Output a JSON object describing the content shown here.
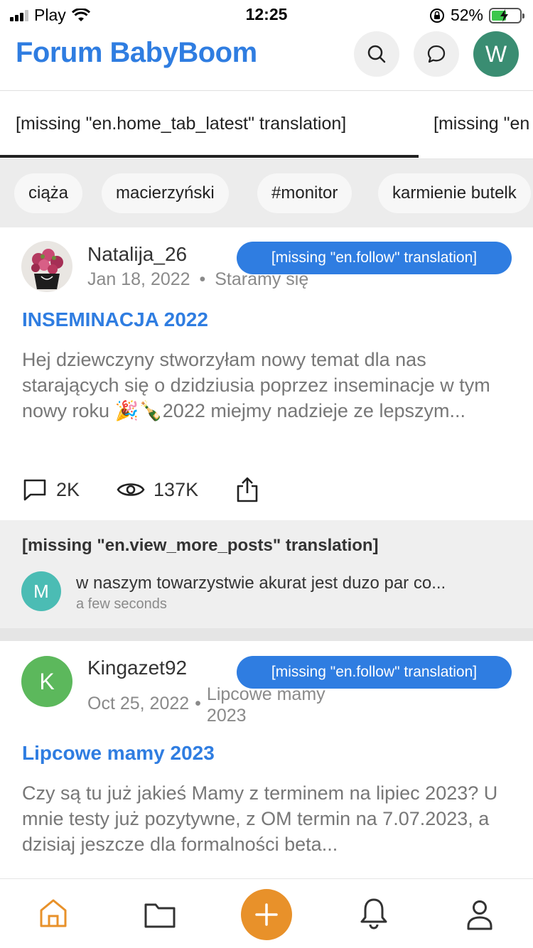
{
  "status_bar": {
    "carrier": "Play",
    "time": "12:25",
    "battery_percent": "52%",
    "battery_level": 0.52
  },
  "header": {
    "title": "Forum BabyBoom",
    "avatar_letter": "W",
    "icons": [
      "search-icon",
      "chat-bubble-icon"
    ]
  },
  "tabs": [
    {
      "label": "[missing \"en.home_tab_latest\" translation]",
      "active": true
    },
    {
      "label": "[missing \"en"
    }
  ],
  "tags": [
    "ciąża",
    "macierzyński",
    "#monitor",
    "karmienie butelk"
  ],
  "posts": [
    {
      "author": "Natalija_26",
      "date": "Jan 18, 2022",
      "group": "Staramy się",
      "follow_label": "[missing \"en.follow\" translation]",
      "title": "INSEMINACJA 2022",
      "excerpt": "Hej dziewczyny stworzyłam nowy temat dla nas starających się o dzidziusia poprzez inseminacje w tym nowy roku 🎉🍾2022 miejmy nadzieje ze lepszym...",
      "comments": "2K",
      "views": "137K",
      "more_posts_label": "[missing \"en.view_more_posts\" translation]",
      "reply": {
        "avatar_letter": "M",
        "text": "w naszym towarzystwie akurat jest duzo par co...",
        "time": "a few seconds"
      }
    },
    {
      "author": "Kingazet92",
      "avatar_letter": "K",
      "date": "Oct 25, 2022",
      "group": "Lipcowe mamy 2023",
      "follow_label": "[missing \"en.follow\" translation]",
      "title": "Lipcowe mamy 2023",
      "excerpt": "Czy są tu już jakieś Mamy z terminem na lipiec 2023? U mnie testy już pozytywne, z OM termin na 7.07.2023, a dzisiaj jeszcze dla formalności beta..."
    }
  ],
  "colors": {
    "accent": "#2f7de1",
    "fab": "#e8912a",
    "home_active": "#e8912a",
    "avatar_w": "#3a8d72",
    "avatar_m": "#4bbcb4",
    "avatar_k": "#5cb85c"
  },
  "bottom_nav": [
    "home-icon",
    "folder-icon",
    "plus-icon",
    "bell-icon",
    "user-icon"
  ]
}
